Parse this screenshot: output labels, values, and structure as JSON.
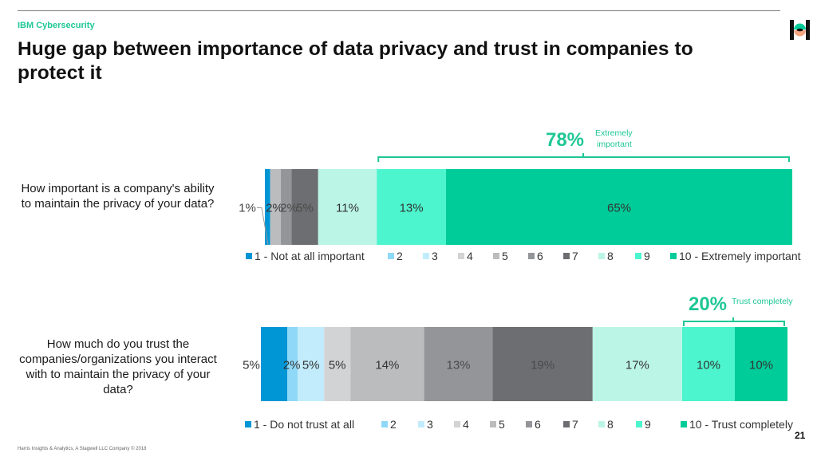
{
  "header": {
    "brand": "IBM Cybersecurity",
    "title": "Huge gap between importance of data privacy and trust in companies to protect it",
    "logo_icon": "harris-logo-icon"
  },
  "footer": {
    "credit": "Harris Insights & Analytics, A Stagwell LLC Company © 2018",
    "page_number": "21"
  },
  "colors": {
    "accent": "#1fc795",
    "scale": [
      "#0096d6",
      "#8fd8f8",
      "#c2ecfc",
      "#d2d3d4",
      "#bbbcbe",
      "#939598",
      "#6d6e71",
      "#bbf5e6",
      "#4cf5cd",
      "#00cc99"
    ]
  },
  "chart_data": [
    {
      "type": "bar",
      "orientation": "horizontal-stacked",
      "question": "How important is a company's ability to maintain the privacy of your data?",
      "categories": [
        "1 - Not at all important",
        "2",
        "3",
        "4",
        "5",
        "6",
        "7",
        "8",
        "9",
        "10 - Extremely important"
      ],
      "values": [
        1,
        0,
        0,
        0,
        2,
        2,
        5,
        11,
        13,
        65
      ],
      "labels": [
        "1%",
        "",
        "",
        "",
        "2%",
        "2%",
        "5%",
        "11%",
        "13%",
        "65%"
      ],
      "xlim": [
        0,
        100
      ],
      "legend_position": "bottom",
      "annotation": {
        "value": "78%",
        "text": "Extremely important",
        "bracket_categories": [
          "9",
          "10 - Extremely important"
        ]
      }
    },
    {
      "type": "bar",
      "orientation": "horizontal-stacked",
      "question": "How much do you trust the companies/organizations you interact with to maintain the privacy of your data?",
      "categories": [
        "1 - Do not trust at all",
        "2",
        "3",
        "4",
        "5",
        "6",
        "7",
        "8",
        "9",
        "10 - Trust completely"
      ],
      "values": [
        5,
        2,
        5,
        5,
        14,
        13,
        19,
        17,
        10,
        10
      ],
      "labels": [
        "5%",
        "2%",
        "5%",
        "5%",
        "14%",
        "13%",
        "19%",
        "17%",
        "10%",
        "10%"
      ],
      "xlim": [
        0,
        100
      ],
      "legend_position": "bottom",
      "annotation": {
        "value": "20%",
        "text": "Trust completely",
        "bracket_categories": [
          "9",
          "10 - Trust completely"
        ]
      }
    }
  ]
}
